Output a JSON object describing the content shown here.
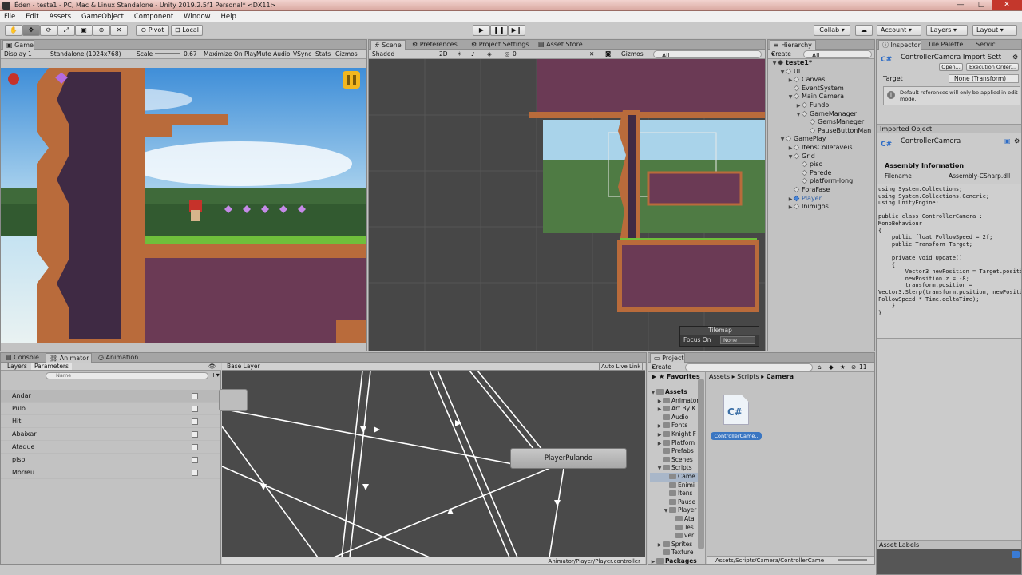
{
  "window": {
    "title": "Éden - teste1 - PC, Mac & Linux Standalone - Unity 2019.2.5f1 Personal* <DX11>",
    "minimize": "—",
    "maximize": "□",
    "close": "✕"
  },
  "menu": [
    "File",
    "Edit",
    "Assets",
    "GameObject",
    "Component",
    "Window",
    "Help"
  ],
  "toolbar": {
    "pivot": "Pivot",
    "local": "Local",
    "collab": "Collab ▾",
    "account": "Account",
    "layers": "Layers",
    "layout": "Layout"
  },
  "game": {
    "tab": "Game",
    "display": "Display 1",
    "resolution": "Standalone (1024x768)",
    "scale_label": "Scale",
    "scale_value": "0.67",
    "maximize": "Maximize On Play",
    "mute": "Mute Audio",
    "vsync": "VSync",
    "stats": "Stats",
    "gizmos": "Gizmos"
  },
  "scene": {
    "tabs": [
      "Scene",
      "Preferences",
      "Project Settings",
      "Asset Store"
    ],
    "shading": "Shaded",
    "mode2d": "2D",
    "gizmos": "Gizmos",
    "search_placeholder": "All",
    "layer_count": "0",
    "tilemap_title": "Tilemap",
    "focus_on": "Focus On",
    "focus_value": "None"
  },
  "hierarchy": {
    "tab": "Hierarchy",
    "create": "Create",
    "search_placeholder": "All",
    "items": [
      {
        "label": "teste1*",
        "indent": 0,
        "arrow": "▼",
        "bold": true,
        "icon": "unity"
      },
      {
        "label": "UI",
        "indent": 1,
        "arrow": "▼",
        "bold": false,
        "icon": "gameobject"
      },
      {
        "label": "Canvas",
        "indent": 2,
        "arrow": "▶",
        "bold": false,
        "icon": "gameobject"
      },
      {
        "label": "EventSystem",
        "indent": 2,
        "arrow": "",
        "bold": false,
        "icon": "gameobject"
      },
      {
        "label": "Main Camera",
        "indent": 2,
        "arrow": "▼",
        "bold": false,
        "icon": "gameobject"
      },
      {
        "label": "Fundo",
        "indent": 3,
        "arrow": "▶",
        "bold": false,
        "icon": "gameobject"
      },
      {
        "label": "GameManager",
        "indent": 3,
        "arrow": "▼",
        "bold": false,
        "icon": "gameobject"
      },
      {
        "label": "GemsManeger",
        "indent": 4,
        "arrow": "",
        "bold": false,
        "icon": "gameobject"
      },
      {
        "label": "PauseButtonMan",
        "indent": 4,
        "arrow": "",
        "bold": false,
        "icon": "gameobject"
      },
      {
        "label": "GamePlay",
        "indent": 1,
        "arrow": "▼",
        "bold": false,
        "icon": "gameobject"
      },
      {
        "label": "ItensColletaveis",
        "indent": 2,
        "arrow": "▶",
        "bold": false,
        "icon": "gameobject"
      },
      {
        "label": "Grid",
        "indent": 2,
        "arrow": "▼",
        "bold": false,
        "icon": "gameobject"
      },
      {
        "label": "piso",
        "indent": 3,
        "arrow": "",
        "bold": false,
        "icon": "gameobject"
      },
      {
        "label": "Parede",
        "indent": 3,
        "arrow": "",
        "bold": false,
        "icon": "gameobject"
      },
      {
        "label": "platform-long",
        "indent": 3,
        "arrow": "",
        "bold": false,
        "icon": "gameobject"
      },
      {
        "label": "ForaFase",
        "indent": 2,
        "arrow": "",
        "bold": false,
        "icon": "gameobject"
      },
      {
        "label": "Player",
        "indent": 2,
        "arrow": "▶",
        "bold": false,
        "icon": "prefab"
      },
      {
        "label": "Inimigos",
        "indent": 2,
        "arrow": "▶",
        "bold": false,
        "icon": "gameobject"
      }
    ]
  },
  "inspector": {
    "tabs": [
      "Inspector",
      "Tile Palette",
      "Servic"
    ],
    "title": "ControllerCamera Import Sett",
    "open": "Open...",
    "exec_order": "Execution Order...",
    "target_label": "Target",
    "target_value": "None (Transform)",
    "info": "Default references will only be applied in edit mode.",
    "imported_header": "Imported Object",
    "imported_name": "ControllerCamera",
    "assembly_header": "Assembly Information",
    "filename_label": "Filename",
    "filename_value": "Assembly-CSharp.dll",
    "code": "using System.Collections;\nusing System.Collections.Generic;\nusing UnityEngine;\n\npublic class ControllerCamera :\nMonoBehaviour\n{\n    public float FollowSpeed = 2f;\n    public Transform Target;\n\n    private void Update()\n    {\n        Vector3 newPosition = Target.position;\n        newPosition.z = -8;\n        transform.position =\nVector3.Slerp(transform.position, newPosition,\nFollowSpeed * Time.deltaTime);\n    }\n}",
    "asset_labels": "Asset Labels"
  },
  "animator": {
    "tabs": [
      "Console",
      "Animator",
      "Animation"
    ],
    "sub_tabs": [
      "Layers",
      "Parameters"
    ],
    "search_placeholder": "Name",
    "base_layer": "Base Layer",
    "auto_live": "Auto Live Link",
    "params": [
      "Andar",
      "Pulo",
      "Hit",
      "Abaixar",
      "Ataque",
      "piso",
      "Morreu"
    ],
    "state_node": "PlayerPulando",
    "path": "Animator/Player/Player.controller"
  },
  "project": {
    "tab": "Project",
    "create": "Create",
    "count": "11",
    "favorites": "Favorites",
    "breadcrumb": [
      "Assets",
      "Scripts",
      "Camera"
    ],
    "tree": [
      {
        "label": "Assets",
        "indent": 0,
        "arrow": "▼",
        "bold": true
      },
      {
        "label": "Animator",
        "indent": 1,
        "arrow": "▶",
        "bold": false
      },
      {
        "label": "Art By K",
        "indent": 1,
        "arrow": "▶",
        "bold": false
      },
      {
        "label": "Audio",
        "indent": 1,
        "arrow": "",
        "bold": false
      },
      {
        "label": "Fonts",
        "indent": 1,
        "arrow": "▶",
        "bold": false
      },
      {
        "label": "Knight F",
        "indent": 1,
        "arrow": "▶",
        "bold": false
      },
      {
        "label": "Platforn",
        "indent": 1,
        "arrow": "▶",
        "bold": false
      },
      {
        "label": "Prefabs",
        "indent": 1,
        "arrow": "",
        "bold": false
      },
      {
        "label": "Scenes",
        "indent": 1,
        "arrow": "",
        "bold": false
      },
      {
        "label": "Scripts",
        "indent": 1,
        "arrow": "▼",
        "bold": false
      },
      {
        "label": "Came",
        "indent": 2,
        "arrow": "",
        "bold": false
      },
      {
        "label": "Enimi",
        "indent": 2,
        "arrow": "",
        "bold": false
      },
      {
        "label": "Itens",
        "indent": 2,
        "arrow": "",
        "bold": false
      },
      {
        "label": "Pause",
        "indent": 2,
        "arrow": "",
        "bold": false
      },
      {
        "label": "Player",
        "indent": 2,
        "arrow": "▼",
        "bold": false
      },
      {
        "label": "Ata",
        "indent": 3,
        "arrow": "",
        "bold": false
      },
      {
        "label": "Tes",
        "indent": 3,
        "arrow": "",
        "bold": false
      },
      {
        "label": "ver",
        "indent": 3,
        "arrow": "",
        "bold": false
      },
      {
        "label": "Sprites",
        "indent": 1,
        "arrow": "▶",
        "bold": false
      },
      {
        "label": "Texture",
        "indent": 1,
        "arrow": "",
        "bold": false
      },
      {
        "label": "Packages",
        "indent": 0,
        "arrow": "▶",
        "bold": true
      }
    ],
    "asset_icon": "C#",
    "asset_name": "ControllerCame..",
    "footer_path": "Assets/Scripts/Camera/ControllerCame"
  }
}
